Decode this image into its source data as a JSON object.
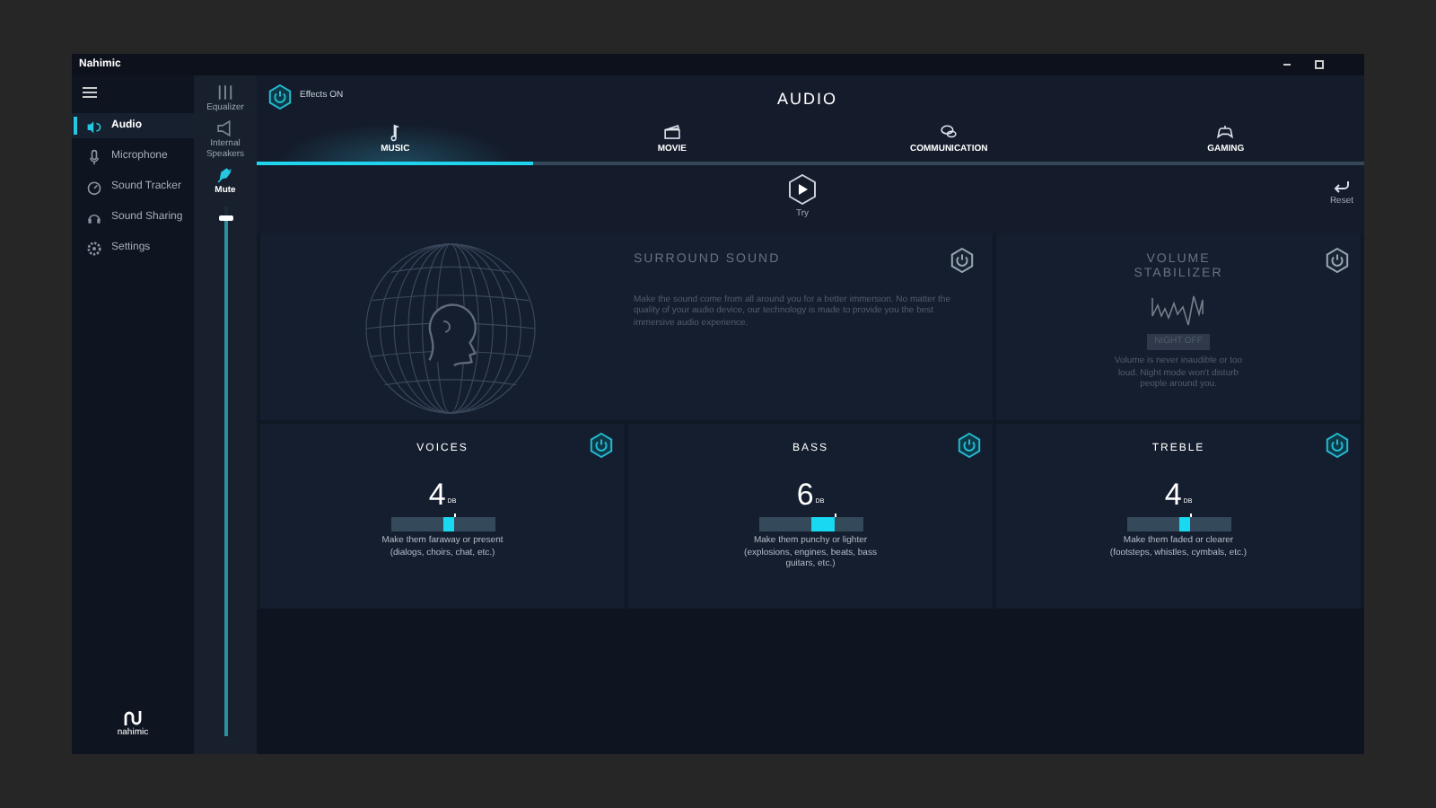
{
  "window": {
    "title": "Nahimic"
  },
  "sidebar": {
    "items": [
      {
        "label": "Audio",
        "selected": true
      },
      {
        "label": "Microphone",
        "selected": false
      },
      {
        "label": "Sound Tracker",
        "selected": false
      },
      {
        "label": "Sound Sharing",
        "selected": false
      },
      {
        "label": "Settings",
        "selected": false
      }
    ],
    "logo_text": "nahimic"
  },
  "device_panel": {
    "items": [
      {
        "label": "Equalizer",
        "selected": false
      },
      {
        "label": "Internal Speakers",
        "selected": false
      },
      {
        "label": "Mute",
        "selected": true
      }
    ],
    "volume": {
      "level": 0.98
    }
  },
  "header": {
    "title": "AUDIO",
    "effects": {
      "label": "Effects ON",
      "on": true
    }
  },
  "tabs": [
    {
      "label": "MUSIC",
      "selected": true
    },
    {
      "label": "MOVIE",
      "selected": false
    },
    {
      "label": "COMMUNICATION",
      "selected": false
    },
    {
      "label": "GAMING",
      "selected": false
    }
  ],
  "try_button": {
    "label": "Try"
  },
  "reset_button": {
    "label": "Reset"
  },
  "surround": {
    "title": "SURROUND SOUND",
    "description": "Make the sound come from all around you for a better immersion. No matter the quality of your audio device, our technology is made to provide you the best immersive audio experience.",
    "on": false
  },
  "volume_stabilizer": {
    "title": "VOLUME STABILIZER",
    "mode_button": "NIGHT OFF",
    "description": "Volume is never inaudible or too loud. Night mode won't disturb people around you.",
    "on": false
  },
  "tuners": [
    {
      "title": "VOICES",
      "value": "4",
      "unit": "DB",
      "level": 0.62,
      "description": "Make them faraway or present (dialogs, choirs, chat, etc.)",
      "on": true
    },
    {
      "title": "BASS",
      "value": "6",
      "unit": "DB",
      "level": 0.73,
      "description": "Make them punchy or lighter (explosions, engines, beats, bass guitars, etc.)",
      "on": true
    },
    {
      "title": "TREBLE",
      "value": "4",
      "unit": "DB",
      "level": 0.62,
      "description": "Make them faded or clearer (footsteps, whistles, cymbals, etc.)",
      "on": true
    }
  ]
}
